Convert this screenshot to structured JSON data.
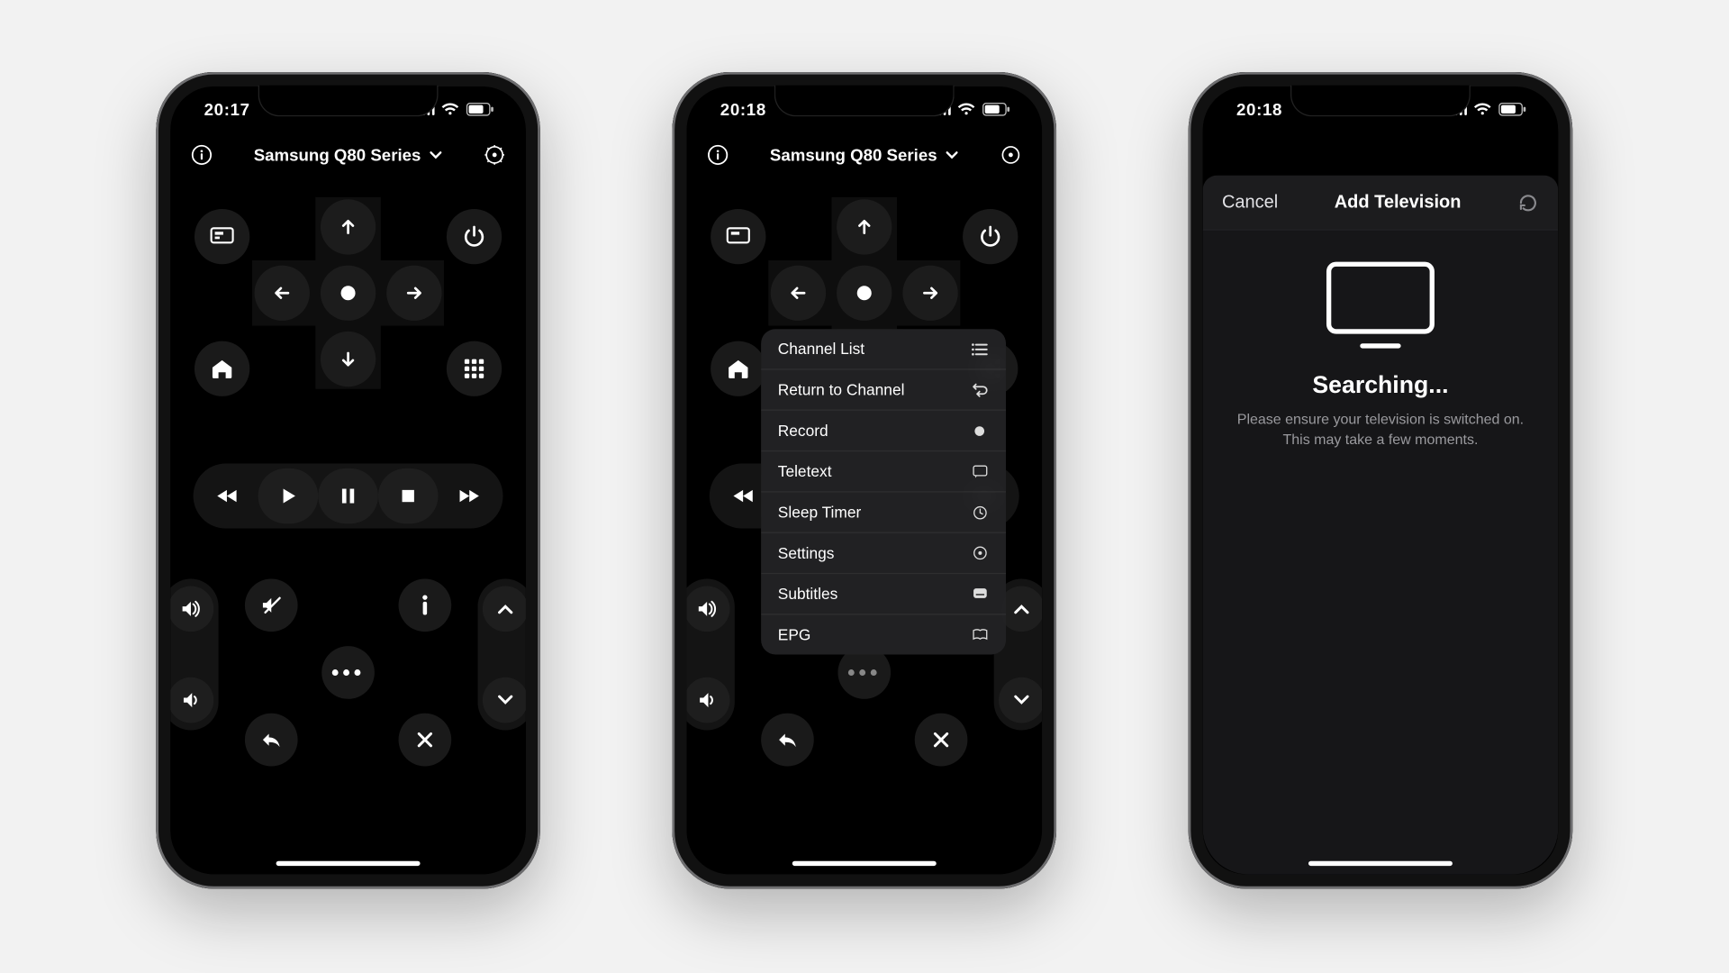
{
  "status": {
    "time1": "20:17",
    "time2": "20:18",
    "time3": "20:18"
  },
  "header": {
    "device": "Samsung Q80 Series"
  },
  "menu": {
    "items": [
      {
        "label": "Channel List",
        "icon": "list"
      },
      {
        "label": "Return to Channel",
        "icon": "return"
      },
      {
        "label": "Record",
        "icon": "record"
      },
      {
        "label": "Teletext",
        "icon": "teletext"
      },
      {
        "label": "Sleep Timer",
        "icon": "timer"
      },
      {
        "label": "Settings",
        "icon": "settings"
      },
      {
        "label": "Subtitles",
        "icon": "subtitles"
      },
      {
        "label": "EPG",
        "icon": "epg"
      }
    ]
  },
  "modal": {
    "cancel": "Cancel",
    "title": "Add Television",
    "heading": "Searching...",
    "line1": "Please ensure your television is switched on.",
    "line2": "This may take a few moments."
  }
}
